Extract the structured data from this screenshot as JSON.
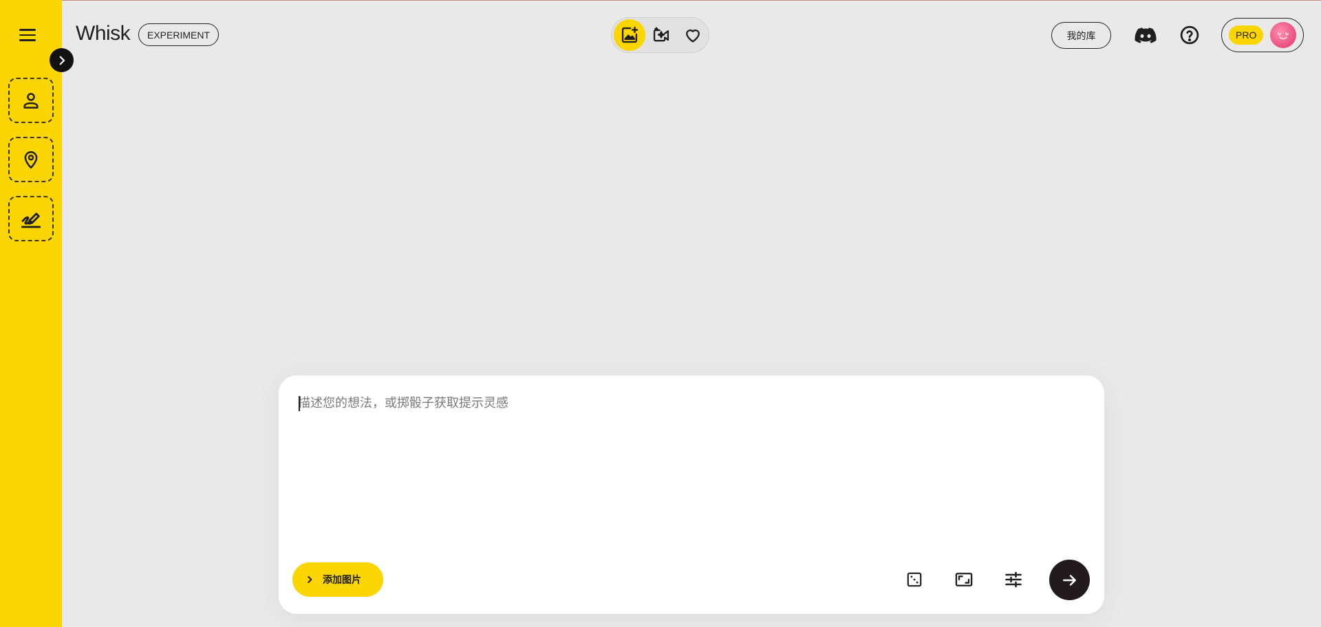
{
  "app": {
    "name": "Whisk",
    "badge": "EXPERIMENT"
  },
  "colors": {
    "accent": "#fad500",
    "background": "#e9e9e9",
    "dark": "#221a1d"
  },
  "sidebar": {
    "menu_icon": "hamburger-menu-icon",
    "expand_icon": "chevron-right-icon",
    "slots": [
      {
        "name": "subject",
        "icon": "person-icon"
      },
      {
        "name": "scene",
        "icon": "location-pin-icon"
      },
      {
        "name": "style",
        "icon": "brush-stroke-icon"
      }
    ]
  },
  "header": {
    "modes": [
      {
        "name": "image",
        "icon": "image-sparkle-icon",
        "active": true
      },
      {
        "name": "video",
        "icon": "video-sparkle-icon",
        "active": false
      },
      {
        "name": "favorites",
        "icon": "heart-icon",
        "active": false
      }
    ],
    "library_label": "我的库",
    "discord_icon": "discord-icon",
    "help_icon": "help-circle-icon",
    "pro_label": "PRO"
  },
  "prompt": {
    "placeholder": "描述您的想法，或掷骰子获取提示灵感",
    "value": "",
    "add_image_label": "添加图片",
    "tools": [
      {
        "name": "random-dice",
        "icon": "dice-icon"
      },
      {
        "name": "aspect-ratio",
        "icon": "aspect-ratio-icon"
      },
      {
        "name": "settings",
        "icon": "sliders-icon"
      }
    ],
    "send_icon": "arrow-right-icon"
  }
}
